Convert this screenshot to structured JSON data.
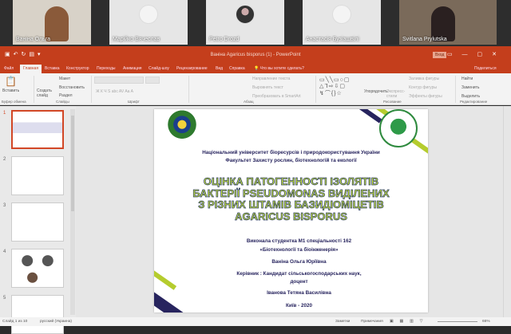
{
  "participants": [
    {
      "name": "Ваніна Ольга"
    },
    {
      "name": "Марійко Вячеслав"
    },
    {
      "name": "Petro Drozd"
    },
    {
      "name": "Анастасія Бузіашвілі"
    },
    {
      "name": "Svitlana Prylutska"
    }
  ],
  "window": {
    "title": "Ваніна Agaricus bisporus (1) - PowerPoint",
    "login": "Вход",
    "share": "Поделиться"
  },
  "tabs": [
    "Файл",
    "Главная",
    "Вставка",
    "Конструктор",
    "Переходы",
    "Анимация",
    "Слайд-шоу",
    "Рецензирование",
    "Вид",
    "Справка"
  ],
  "tell_me": "Что вы хотите сделать?",
  "ribbon": {
    "clipboard": {
      "paste": "Вставить",
      "group": "Буфер обмена"
    },
    "slides": {
      "new": "Создать слайд",
      "layout": "Макет",
      "reset": "Восстановить",
      "section": "Раздел",
      "group": "Слайды"
    },
    "font": {
      "group": "Шрифт"
    },
    "paragraph": {
      "dir": "Направление текста",
      "align": "Выровнять текст",
      "smartart": "Преобразовать в SmartArt",
      "group": "Абзац"
    },
    "drawing": {
      "arrange": "Упорядочить",
      "styles": "Экспресс-стили",
      "fill": "Заливка фигуры",
      "outline": "Контур фигуры",
      "effects": "Эффекты фигуры",
      "group": "Рисование"
    },
    "editing": {
      "find": "Найти",
      "replace": "Заменить",
      "select": "Выделить",
      "group": "Редактирование"
    }
  },
  "thumbnails": [
    "1",
    "2",
    "3",
    "4",
    "5"
  ],
  "slide": {
    "university": "Національний університет біоресурсів і природокористування України",
    "faculty": "Факультет Захисту рослин, біотехнологій та екології",
    "title": [
      "ОЦІНКА ПАТОГЕННОСТІ ІЗОЛЯТІВ",
      "БАКТЕРІЇ PSEUDOMONAS ВИДІЛЕНИХ",
      "З  РІЗНИХ ШТАМІВ БАЗИДІОМІЦЕТІВ",
      "AGARICUS BISPORUS"
    ],
    "performed": "Виконала  студентка М1 спеціальності 162",
    "specialty": "«Біотехнології та  біоінженерія»",
    "student": "Ваніна Ольга Юріївна",
    "supervisor": "Керівник : Кандидат сільськогосподарських наук,",
    "position": "доцент",
    "supervisor_name": "Іванова Тетяна Василівна",
    "city_year": "Київ - 2020"
  },
  "status": {
    "slide": "Слайд 1 из 10",
    "language": "русский (Украина)",
    "notes": "Заметки",
    "comments": "Примечания",
    "zoom": "66%"
  },
  "colors": {
    "accent": "#c43e1c",
    "navy": "#27245e",
    "lime": "#b5cc2e"
  }
}
